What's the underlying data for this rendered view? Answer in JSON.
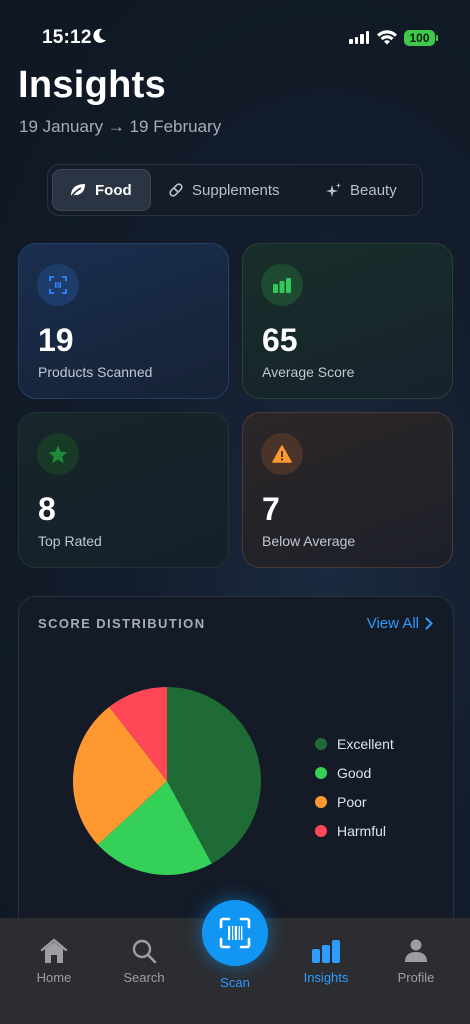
{
  "status_bar": {
    "time": "15:12",
    "battery": "100"
  },
  "header": {
    "title": "Insights",
    "date_range": "19 January → 19 February"
  },
  "segments": [
    {
      "label": "Food",
      "icon": "leaf-icon",
      "active": true
    },
    {
      "label": "Supplements",
      "icon": "pill-icon",
      "active": false
    },
    {
      "label": "Beauty",
      "icon": "sparkle-icon",
      "active": false
    }
  ],
  "stats": {
    "products_scanned": {
      "value": "19",
      "label": "Products Scanned",
      "icon": "barcode-icon",
      "color": "#2f86ff"
    },
    "average_score": {
      "value": "65",
      "label": "Average Score",
      "icon": "bar-chart-icon",
      "color": "#34c759"
    },
    "top_rated": {
      "value": "8",
      "label": "Top Rated",
      "icon": "star-icon",
      "color": "#1f8a3a"
    },
    "below_average": {
      "value": "7",
      "label": "Below Average",
      "icon": "warning-icon",
      "color": "#ff9830"
    }
  },
  "distribution": {
    "title": "SCORE DISTRIBUTION",
    "view_all": "View All",
    "legend": [
      {
        "label": "Excellent",
        "color": "#1f6b36"
      },
      {
        "label": "Good",
        "color": "#34d058"
      },
      {
        "label": "Poor",
        "color": "#ff9830"
      },
      {
        "label": "Harmful",
        "color": "#ff4757"
      }
    ]
  },
  "chart_data": {
    "type": "pie",
    "categories": [
      "Excellent",
      "Good",
      "Poor",
      "Harmful"
    ],
    "values": [
      8,
      4,
      5,
      2
    ],
    "colors": [
      "#1f6b36",
      "#34d058",
      "#ff9830",
      "#ff4757"
    ]
  },
  "tab_bar": {
    "home": "Home",
    "search": "Search",
    "scan": "Scan",
    "insights": "Insights",
    "profile": "Profile",
    "active": "Insights"
  }
}
